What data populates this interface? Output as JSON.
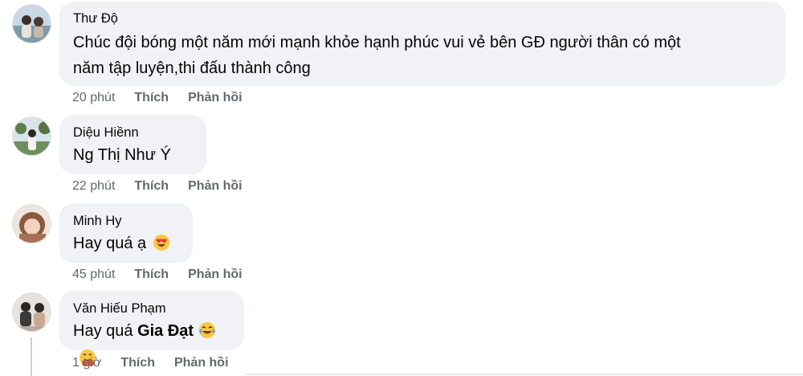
{
  "comments": [
    {
      "author": "Thư Độ",
      "text": "Chúc đội bóng một năm mới mạnh khỏe hạnh phúc vui vẻ bên GĐ người thân có một",
      "text2": "năm tập luyện,thi đấu thành công",
      "time": "20 phút",
      "like": "Thích",
      "reply": "Phản hồi"
    },
    {
      "author": "Diệu Hiềnn",
      "text": "Ng Thị Như Ý",
      "time": "22 phút",
      "like": "Thích",
      "reply": "Phản hồi"
    },
    {
      "author": "Minh Hy",
      "text": "Hay quá ạ",
      "emoji": "heart-eyes-emoji",
      "time": "45 phút",
      "like": "Thích",
      "reply": "Phản hồi"
    },
    {
      "author": "Văn Hiếu Phạm",
      "text": "Hay quá",
      "mention": "Gia Đạt",
      "emoji1": "laughing-tears-emoji",
      "emoji2": "hugging-emoji",
      "time": "1 giờ",
      "like": "Thích",
      "reply": "Phản hồi"
    }
  ],
  "colors": {
    "bubble": "#f0f2f5",
    "meta_text": "#65676b",
    "primary_text": "#050505"
  }
}
